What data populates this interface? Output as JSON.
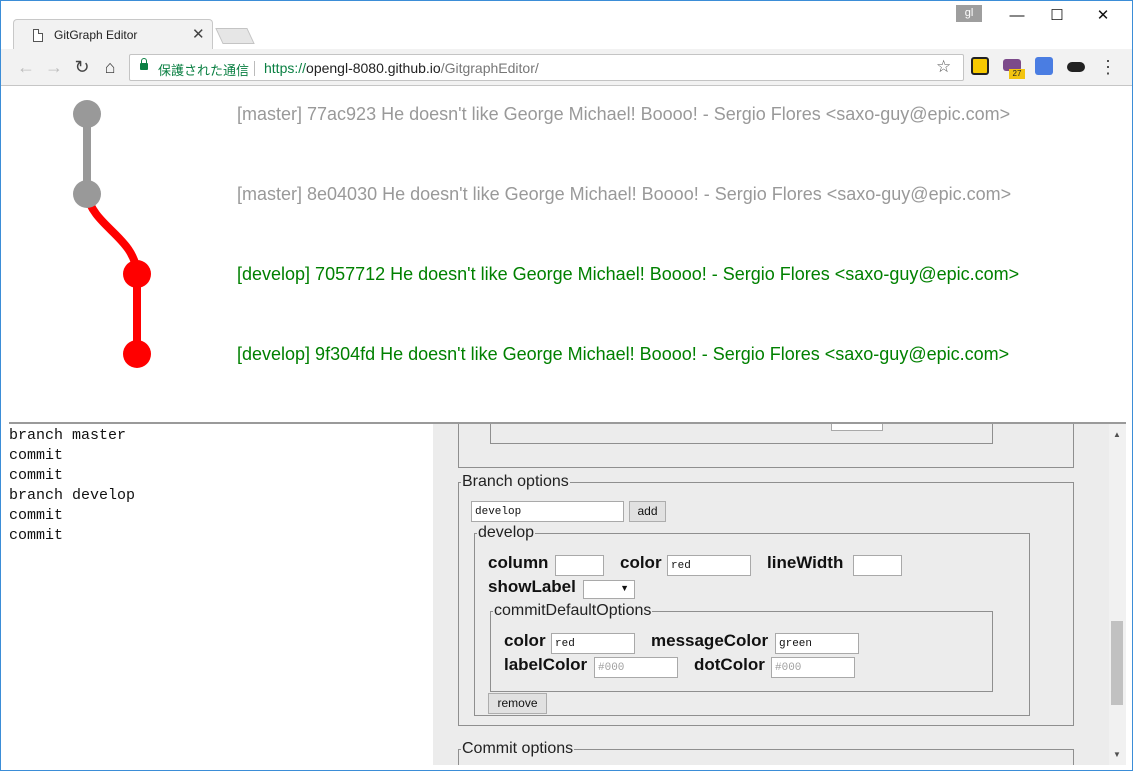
{
  "browser": {
    "tab_title": "GitGraph Editor",
    "tab_close": "✕",
    "profile_initials": "gl",
    "security_label": "保護された通信",
    "url_scheme": "https://",
    "url_host": "opengl-8080.github.io",
    "url_path": "/GitgraphEditor/",
    "extension_badge": "27",
    "win_minimize": "—",
    "win_maximize": "☐",
    "win_close": "✕"
  },
  "graph": {
    "commits": [
      {
        "label": "[master] 77ac923 He doesn't like George Michael! Boooo! - Sergio Flores <saxo-guy@epic.com>",
        "color": "#999999"
      },
      {
        "label": "[master] 8e04030 He doesn't like George Michael! Boooo! - Sergio Flores <saxo-guy@epic.com>",
        "color": "#999999"
      },
      {
        "label": "[develop] 7057712 He doesn't like George Michael! Boooo! - Sergio Flores <saxo-guy@epic.com>",
        "color": "#008000"
      },
      {
        "label": "[develop] 9f304fd He doesn't like George Michael! Boooo! - Sergio Flores <saxo-guy@epic.com>",
        "color": "#008000"
      }
    ],
    "branch_colors": {
      "master": "#999999",
      "develop": "#ff0000"
    }
  },
  "editor": {
    "lines": [
      "branch master",
      "commit",
      "commit",
      "branch develop",
      "commit",
      "commit"
    ]
  },
  "options": {
    "branch_options": {
      "legend": "Branch options",
      "new_branch_value": "develop",
      "add_label": "add",
      "branch": {
        "name": "develop",
        "column_label": "column",
        "column_value": "",
        "color_label": "color",
        "color_value": "red",
        "line_width_label": "lineWidth",
        "line_width_value": "",
        "show_label_label": "showLabel",
        "commit_defaults": {
          "legend": "commitDefaultOptions",
          "color_label": "color",
          "color_value": "red",
          "message_color_label": "messageColor",
          "message_color_value": "green",
          "label_color_label": "labelColor",
          "label_color_placeholder": "#000",
          "dot_color_label": "dotColor",
          "dot_color_placeholder": "#000"
        },
        "remove_label": "remove"
      }
    },
    "commit_options": {
      "legend": "Commit options"
    }
  }
}
